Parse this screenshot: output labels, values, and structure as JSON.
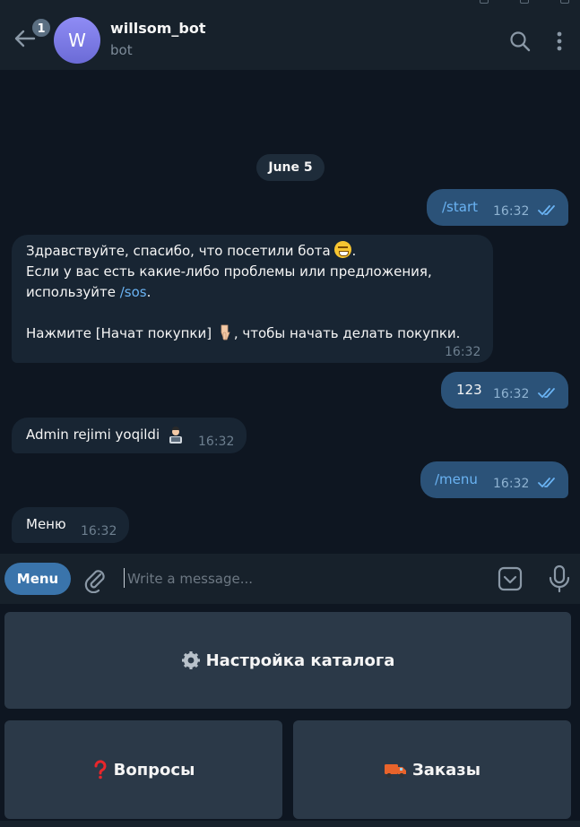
{
  "header": {
    "unread_count": "1",
    "avatar_letter": "W",
    "title": "willsom_bot",
    "subtitle": "bot"
  },
  "date_separator": "June 5",
  "messages": [
    {
      "direction": "out",
      "text": "/start",
      "time": "16:32"
    },
    {
      "direction": "in",
      "line1": "Здравствуйте, спасибо, что посетили бота",
      "line1_end": ".",
      "line2": "Если у вас есть какие-либо проблемы или предложения,",
      "line3_prefix": "используйте ",
      "line3_link": "/sos",
      "line3_suffix": ".",
      "line4_prefix": "Нажмите [Начат покупки]",
      "line4_suffix": ", чтобы начать делать покупки.",
      "time": "16:32"
    },
    {
      "direction": "out",
      "text": "123",
      "time": "16:32"
    },
    {
      "direction": "in",
      "text": "Admin rejimi yoqildi",
      "time": "16:32"
    },
    {
      "direction": "out",
      "text": "/menu",
      "time": "16:32"
    },
    {
      "direction": "in",
      "text": "Меню",
      "time": "16:32"
    }
  ],
  "composer": {
    "menu_label": "Menu",
    "placeholder": "Write a message..."
  },
  "keyboard": {
    "catalog_label": "Настройка каталога",
    "questions_label": "Вопросы",
    "orders_label": "Заказы"
  },
  "colors": {
    "background": "#0e1621",
    "outgoing_bubble": "#2b5278",
    "incoming_bubble": "#182533",
    "link": "#6ab3f3",
    "accent": "#3a74ab"
  }
}
